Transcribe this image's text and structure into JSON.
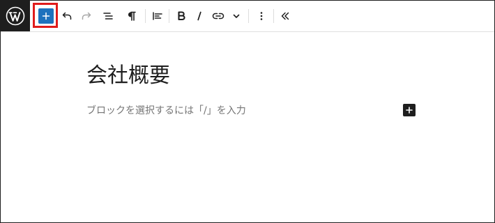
{
  "toolbar": {
    "logo_icon": "wordpress-logo-icon",
    "buttons": [
      {
        "name": "add-block",
        "icon": "plus-icon"
      },
      {
        "name": "undo",
        "icon": "undo-icon"
      },
      {
        "name": "redo",
        "icon": "redo-icon"
      },
      {
        "name": "document-overview",
        "icon": "list-view-icon"
      },
      {
        "name": "paragraph",
        "icon": "paragraph-icon"
      },
      {
        "name": "align",
        "icon": "align-left-icon"
      },
      {
        "name": "bold",
        "icon": "bold-icon"
      },
      {
        "name": "italic",
        "icon": "italic-icon"
      },
      {
        "name": "link",
        "icon": "link-icon"
      },
      {
        "name": "more-rich-text",
        "icon": "chevron-down-icon"
      },
      {
        "name": "options",
        "icon": "more-vertical-icon"
      },
      {
        "name": "collapse",
        "icon": "chevron-double-left-icon"
      }
    ],
    "highlight_color": "#e01b1b"
  },
  "editor": {
    "title": "会社概要",
    "placeholder": "ブロックを選択するには「/」を入力",
    "inline_add_icon": "plus-icon"
  },
  "colors": {
    "logo_bg": "#1e1e1e",
    "accent": "#1e72bd",
    "text": "#1e1e1e",
    "placeholder": "#757575"
  }
}
